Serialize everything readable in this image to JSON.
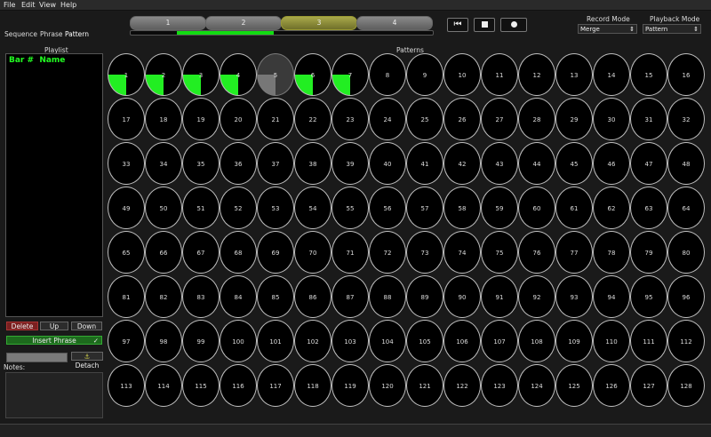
{
  "menu": [
    "File",
    "Edit",
    "View",
    "Help"
  ],
  "tabs": [
    {
      "label": "Sequence",
      "active": false
    },
    {
      "label": "Phrase",
      "active": false
    },
    {
      "label": "Pattern",
      "active": true
    }
  ],
  "beats": [
    {
      "label": "1",
      "active": false
    },
    {
      "label": "2",
      "active": false
    },
    {
      "label": "3",
      "active": true
    },
    {
      "label": "4",
      "active": false
    }
  ],
  "progress_percent": 32,
  "transport": {
    "rewind_icon": "rewind-icon",
    "stop_icon": "stop-icon",
    "record_icon": "record-icon"
  },
  "record_mode": {
    "label": "Record Mode",
    "value": "Merge"
  },
  "playback_mode": {
    "label": "Playback Mode",
    "value": "Pattern"
  },
  "playlist": {
    "label": "Playlist",
    "header_bar": "Bar #",
    "header_name": "Name"
  },
  "buttons": {
    "delete": "Delete",
    "up": "Up",
    "down": "Down",
    "insert_phrase": "Insert Phrase",
    "insert_check": "✓",
    "detach": "Detach",
    "detach_icon": "⚓"
  },
  "notes_label": "Notes:",
  "patterns_label": "Patterns",
  "patterns": [
    {
      "n": "1",
      "fill": 0.25,
      "color": "#22ee22"
    },
    {
      "n": "2",
      "fill": 0.25,
      "color": "#22ee22"
    },
    {
      "n": "3",
      "fill": 0.25,
      "color": "#22ee22"
    },
    {
      "n": "4",
      "fill": 0.25,
      "color": "#22ee22"
    },
    {
      "n": "5",
      "fill": 0.25,
      "color": "#777777"
    },
    {
      "n": "6",
      "fill": 0.25,
      "color": "#22ee22"
    },
    {
      "n": "7",
      "fill": 0.25,
      "color": "#22ee22"
    },
    {
      "n": "8"
    },
    {
      "n": "9"
    },
    {
      "n": "10"
    },
    {
      "n": "11"
    },
    {
      "n": "12"
    },
    {
      "n": "13"
    },
    {
      "n": "14"
    },
    {
      "n": "15"
    },
    {
      "n": "16"
    },
    {
      "n": "17"
    },
    {
      "n": "18"
    },
    {
      "n": "19"
    },
    {
      "n": "20"
    },
    {
      "n": "21"
    },
    {
      "n": "22"
    },
    {
      "n": "23"
    },
    {
      "n": "24"
    },
    {
      "n": "25"
    },
    {
      "n": "26"
    },
    {
      "n": "27"
    },
    {
      "n": "28"
    },
    {
      "n": "29"
    },
    {
      "n": "30"
    },
    {
      "n": "31"
    },
    {
      "n": "32"
    },
    {
      "n": "33"
    },
    {
      "n": "34"
    },
    {
      "n": "35"
    },
    {
      "n": "36"
    },
    {
      "n": "37"
    },
    {
      "n": "38"
    },
    {
      "n": "39"
    },
    {
      "n": "40"
    },
    {
      "n": "41"
    },
    {
      "n": "42"
    },
    {
      "n": "43"
    },
    {
      "n": "44"
    },
    {
      "n": "45"
    },
    {
      "n": "46"
    },
    {
      "n": "47"
    },
    {
      "n": "48"
    },
    {
      "n": "49"
    },
    {
      "n": "50"
    },
    {
      "n": "51"
    },
    {
      "n": "52"
    },
    {
      "n": "53"
    },
    {
      "n": "54"
    },
    {
      "n": "55"
    },
    {
      "n": "56"
    },
    {
      "n": "57"
    },
    {
      "n": "58"
    },
    {
      "n": "59"
    },
    {
      "n": "60"
    },
    {
      "n": "61"
    },
    {
      "n": "62"
    },
    {
      "n": "63"
    },
    {
      "n": "64"
    },
    {
      "n": "65"
    },
    {
      "n": "66"
    },
    {
      "n": "67"
    },
    {
      "n": "68"
    },
    {
      "n": "69"
    },
    {
      "n": "70"
    },
    {
      "n": "71"
    },
    {
      "n": "72"
    },
    {
      "n": "73"
    },
    {
      "n": "74"
    },
    {
      "n": "75"
    },
    {
      "n": "76"
    },
    {
      "n": "77"
    },
    {
      "n": "78"
    },
    {
      "n": "79"
    },
    {
      "n": "80"
    },
    {
      "n": "81"
    },
    {
      "n": "82"
    },
    {
      "n": "83"
    },
    {
      "n": "84"
    },
    {
      "n": "85"
    },
    {
      "n": "86"
    },
    {
      "n": "87"
    },
    {
      "n": "88"
    },
    {
      "n": "89"
    },
    {
      "n": "90"
    },
    {
      "n": "91"
    },
    {
      "n": "92"
    },
    {
      "n": "93"
    },
    {
      "n": "94"
    },
    {
      "n": "95"
    },
    {
      "n": "96"
    },
    {
      "n": "97"
    },
    {
      "n": "98"
    },
    {
      "n": "99"
    },
    {
      "n": "100"
    },
    {
      "n": "101"
    },
    {
      "n": "102"
    },
    {
      "n": "103"
    },
    {
      "n": "104"
    },
    {
      "n": "105"
    },
    {
      "n": "106"
    },
    {
      "n": "107"
    },
    {
      "n": "108"
    },
    {
      "n": "109"
    },
    {
      "n": "110"
    },
    {
      "n": "111"
    },
    {
      "n": "112"
    },
    {
      "n": "113"
    },
    {
      "n": "114"
    },
    {
      "n": "115"
    },
    {
      "n": "116"
    },
    {
      "n": "117"
    },
    {
      "n": "118"
    },
    {
      "n": "119"
    },
    {
      "n": "120"
    },
    {
      "n": "121"
    },
    {
      "n": "122"
    },
    {
      "n": "123"
    },
    {
      "n": "124"
    },
    {
      "n": "125"
    },
    {
      "n": "126"
    },
    {
      "n": "127"
    },
    {
      "n": "128"
    }
  ]
}
